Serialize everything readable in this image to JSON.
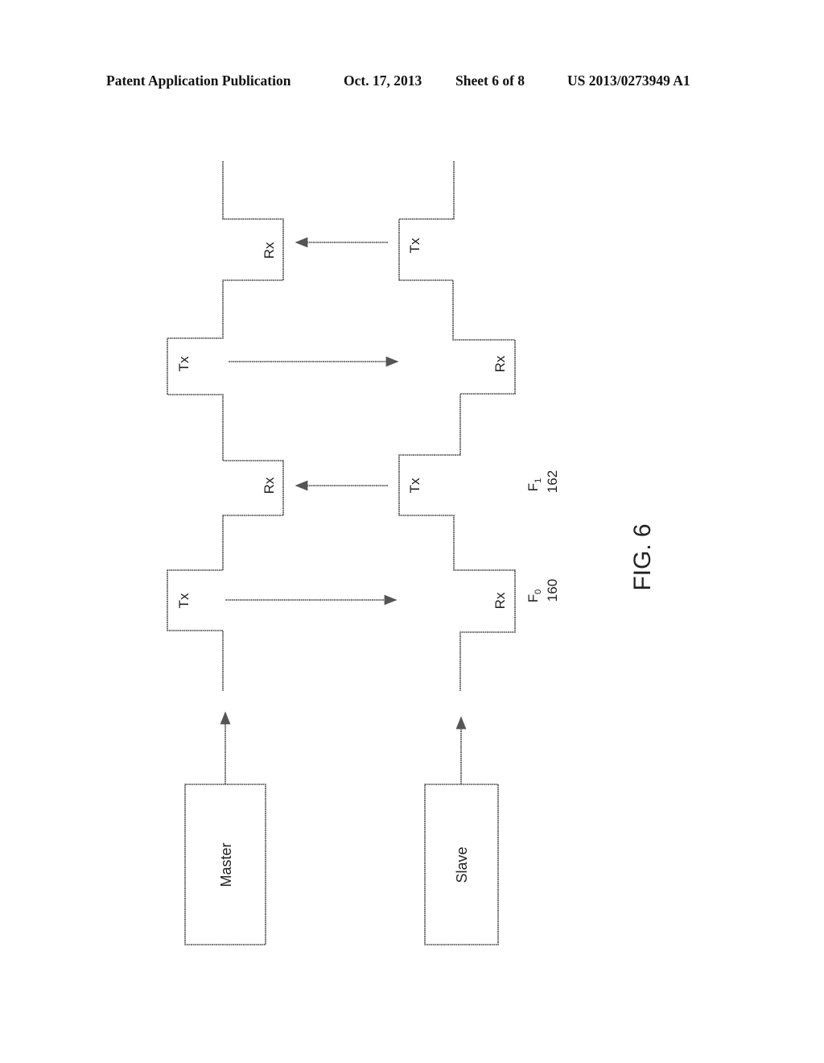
{
  "header": {
    "publication": "Patent Application Publication",
    "date": "Oct. 17, 2013",
    "sheet": "Sheet 6 of 8",
    "number": "US 2013/0273949 A1"
  },
  "figure": {
    "label": "FIG. 6",
    "master_label": "Master",
    "slave_label": "Slave",
    "master_slots": [
      "Tx",
      "Rx",
      "Tx",
      "Rx"
    ],
    "slave_slots": [
      "Rx",
      "Tx",
      "Rx",
      "Tx"
    ],
    "frequencies": [
      {
        "name": "F",
        "sub": "0",
        "ref": "160"
      },
      {
        "name": "F",
        "sub": "1",
        "ref": "162"
      }
    ],
    "arrows": [
      {
        "from": "master",
        "to": "slave",
        "slot": 1
      },
      {
        "from": "slave",
        "to": "master",
        "slot": 2
      },
      {
        "from": "master",
        "to": "slave",
        "slot": 3
      },
      {
        "from": "slave",
        "to": "master",
        "slot": 4
      }
    ]
  }
}
